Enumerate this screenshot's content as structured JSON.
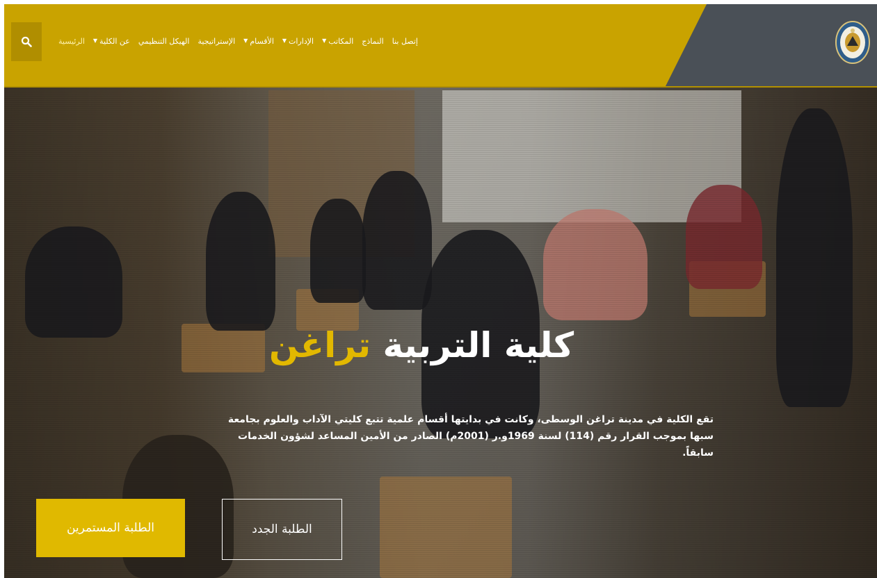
{
  "header": {
    "search_icon": "search-icon",
    "nav": [
      {
        "label": "الرئيسية",
        "has_dropdown": false,
        "active": true
      },
      {
        "label": "عن الكلية",
        "has_dropdown": true,
        "active": false
      },
      {
        "label": "الهيكل التنظيمي",
        "has_dropdown": false,
        "active": false
      },
      {
        "label": "الإستراتيجية",
        "has_dropdown": false,
        "active": false
      },
      {
        "label": "الأقسام",
        "has_dropdown": true,
        "active": false
      },
      {
        "label": "الإدارات",
        "has_dropdown": true,
        "active": false
      },
      {
        "label": "المكاتب",
        "has_dropdown": true,
        "active": false
      },
      {
        "label": "النماذج",
        "has_dropdown": false,
        "active": false
      },
      {
        "label": "إتصل بنا",
        "has_dropdown": false,
        "active": false
      }
    ],
    "colors": {
      "bar": "#c9a300",
      "dark": "#4a5057",
      "accent": "#e2b800"
    }
  },
  "hero": {
    "title_main": "كلية التربية",
    "title_accent": "تراغن",
    "description": "تقع الكلية في مدينة تراغن الوسطى، وكانت في بدايتها أقسام علمية تتبع كليتي الآداب والعلوم بجامعة سبها بموجب القرار رقم (114) لسنة 1969و.ر (2001م) الصادر من الأمين المساعد لشؤون الخدمات سابقاً.",
    "btn_new_students": "الطلبة الجدد",
    "btn_continuing_students": "الطلبة المستمرين"
  }
}
